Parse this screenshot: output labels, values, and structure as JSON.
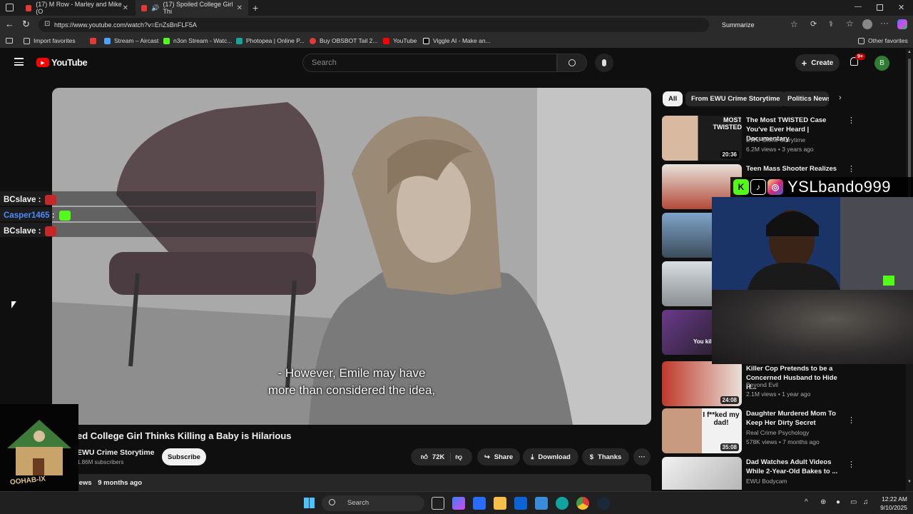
{
  "browser": {
    "tabs": [
      {
        "label": "(17) M Row - Marley and Mike (O",
        "active": false
      },
      {
        "label": "(17) Spoiled College Girl Thi",
        "active": true
      }
    ],
    "url": "https://www.youtube.com/watch?v=EnZsBnFLF5A",
    "summarize_label": "Summarize",
    "bookmarks": [
      {
        "label": "Import favorites",
        "color": "#888888"
      },
      {
        "label": "Stream – Aircast",
        "color": "#4aa3ff"
      },
      {
        "label": "n3on Stream - Watc...",
        "color": "#53fc18"
      },
      {
        "label": "Photopea | Online P...",
        "color": "#18a497"
      },
      {
        "label": "Buy OBSBOT Tail 2...",
        "color": "#e53935"
      },
      {
        "label": "YouTube",
        "color": "#ff0000"
      },
      {
        "label": "Viggle AI - Make an...",
        "color": "#ffffff"
      }
    ],
    "other_favorites": "Other favorites"
  },
  "youtube": {
    "logo_text": "YouTube",
    "search_placeholder": "Search",
    "create_label": "Create",
    "notification_count": "9+",
    "avatar_letter": "B",
    "chips": [
      "All",
      "From EWU Crime Storytime",
      "Politics News"
    ],
    "video": {
      "caption_line1": "- However, Emile may have",
      "caption_line2": "more than considered the idea,",
      "title": "ed College Girl Thinks Killing a Baby is Hilarious",
      "channel": "EWU Crime Storytime",
      "subscribers": "1.86M subscribers",
      "subscribe_label": "Subscribe",
      "likes": "72K",
      "share_label": "Share",
      "download_label": "Download",
      "thanks_label": "Thanks",
      "views_label": "iews",
      "age": "9 months ago"
    },
    "recommendations": [
      {
        "title": "The Most TWISTED Case You've Ever Heard | Documentary",
        "channel": "EWU Crime Storytime",
        "meta": "6.2M views • 3 years ago",
        "duration": "20:36",
        "thumb_text": "MOST TWISTED"
      },
      {
        "title": "Teen Mass Shooter Realizes",
        "channel": "",
        "meta": "",
        "duration": "",
        "thumb_text": ""
      },
      {
        "title": "",
        "channel": "",
        "meta": "",
        "duration": "",
        "thumb_text": ""
      },
      {
        "title": "",
        "channel": "",
        "meta": "",
        "duration": "",
        "thumb_text": ""
      },
      {
        "title": "",
        "channel": "",
        "meta": "",
        "duration": "",
        "thumb_text": "You kill"
      },
      {
        "title": "Killer Cop Pretends to be a Concerned Husband to Hide H...",
        "channel": "Beyond Evil",
        "meta": "2.1M views • 1 year ago",
        "duration": "24:08",
        "thumb_text": ""
      },
      {
        "title": "Daughter Murdered Mom To Keep Her Dirty Secret",
        "channel": "Real Crime Psychology",
        "meta": "578K views • 7 months ago",
        "duration": "35:08",
        "thumb_text": "I f**ked my dad!"
      },
      {
        "title": "Dad Watches Adult Videos While 2-Year-Old Bakes to ...",
        "channel": "EWU Bodycam",
        "meta": "",
        "duration": "",
        "thumb_text": ""
      }
    ]
  },
  "overlay": {
    "chat": [
      {
        "user": "BCslave",
        "color": "#ffffff",
        "emote_color": "#c62828"
      },
      {
        "user": "Casper1465",
        "color": "#4a8cff",
        "emote_color": "#53fc18"
      },
      {
        "user": "BCslave",
        "color": "#ffffff",
        "emote_color": "#c62828"
      }
    ],
    "streamer_handle": "YSLbando999",
    "social_k": "K",
    "logo_text": "OOHAB-IX"
  },
  "taskbar": {
    "search_label": "Search",
    "time": "12:22 AM",
    "date": "9/10/2025"
  }
}
